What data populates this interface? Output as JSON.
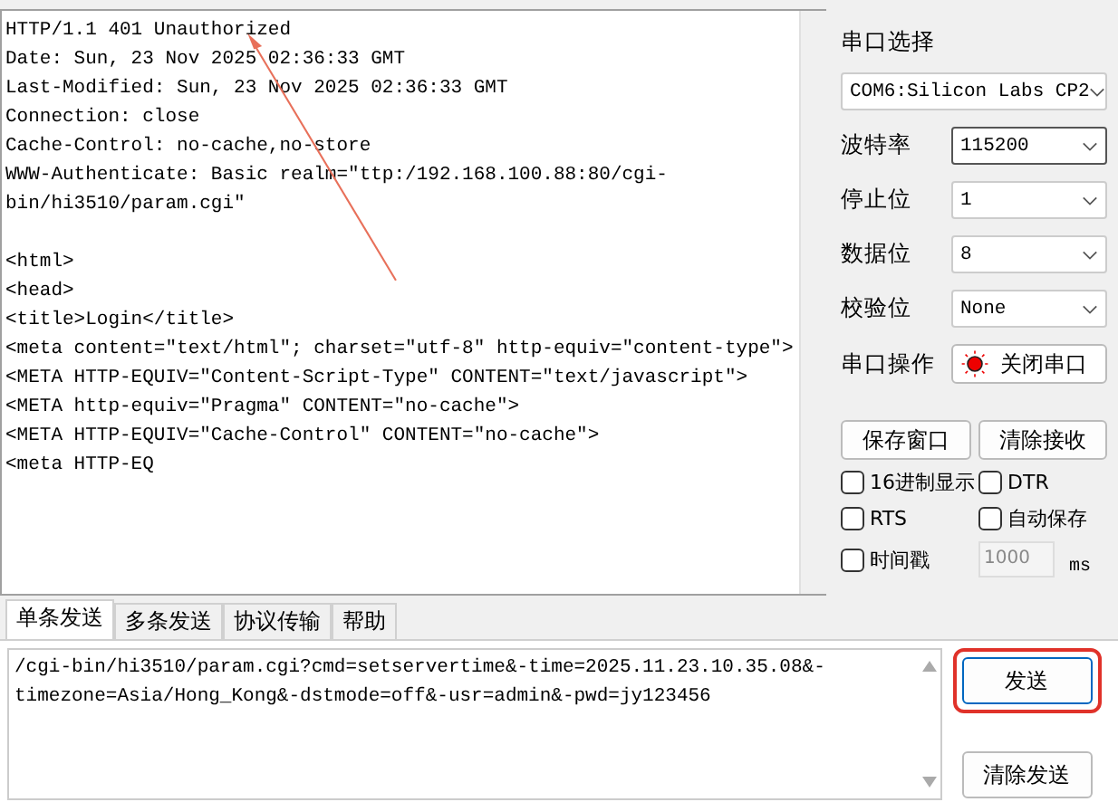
{
  "receive": {
    "headers": [
      "HTTP/1.1 401 Unauthorized",
      "Date: Sun, 23 Nov 2025 02:36:33 GMT",
      "Last-Modified: Sun, 23 Nov 2025 02:36:33 GMT",
      "Connection: close",
      "Cache-Control: no-cache,no-store",
      "WWW-Authenticate: Basic realm=\"ttp:/192.168.100.88:80/cgi-",
      "bin/hi3510/param.cgi\""
    ],
    "body": [
      "<html>",
      "<head>",
      "<title>Login</title>",
      "<meta content=\"text/html\"; charset=\"utf-8\" http-equiv=\"content-type\">",
      "<META HTTP-EQUIV=\"Content-Script-Type\" CONTENT=\"text/javascript\">",
      "<META http-equiv=\"Pragma\" CONTENT=\"no-cache\">",
      "<META HTTP-EQUIV=\"Cache-Control\" CONTENT=\"no-cache\">",
      "<meta HTTP-EQ"
    ]
  },
  "port_panel": {
    "port_label": "串口选择",
    "port_value": "COM6:Silicon Labs CP2",
    "settings": [
      {
        "label": "波特率",
        "value": "115200"
      },
      {
        "label": "停止位",
        "value": "1"
      },
      {
        "label": "数据位",
        "value": "8"
      },
      {
        "label": "校验位",
        "value": "None"
      }
    ],
    "operation_label": "串口操作",
    "operation_button": "关闭串口",
    "port_open": true,
    "buttons": [
      "保存窗口",
      "清除接收"
    ],
    "options": [
      {
        "label": "16进制显示",
        "checked": false
      },
      {
        "label": "DTR",
        "checked": false
      },
      {
        "label": "RTS",
        "checked": false
      },
      {
        "label": "自动保存",
        "checked": false
      },
      {
        "label": "时间戳",
        "checked": false
      }
    ],
    "interval": "1000",
    "interval_unit": "ms"
  },
  "tabs": [
    {
      "label": "单条发送",
      "selected": true
    },
    {
      "label": "多条发送",
      "selected": false
    },
    {
      "label": "协议传输",
      "selected": false
    },
    {
      "label": "帮助",
      "selected": false
    }
  ],
  "send": {
    "lines": [
      "/cgi-bin/hi3510/param.cgi?cmd=setservertime&-time=2025.11.23.10.35.08&-",
      "timezone=Asia/Hong_Kong&-dstmode=off&-usr=admin&-pwd=jy123456"
    ],
    "send_button": "发送",
    "send_highlighted": true,
    "clear_button": "清除发送"
  }
}
